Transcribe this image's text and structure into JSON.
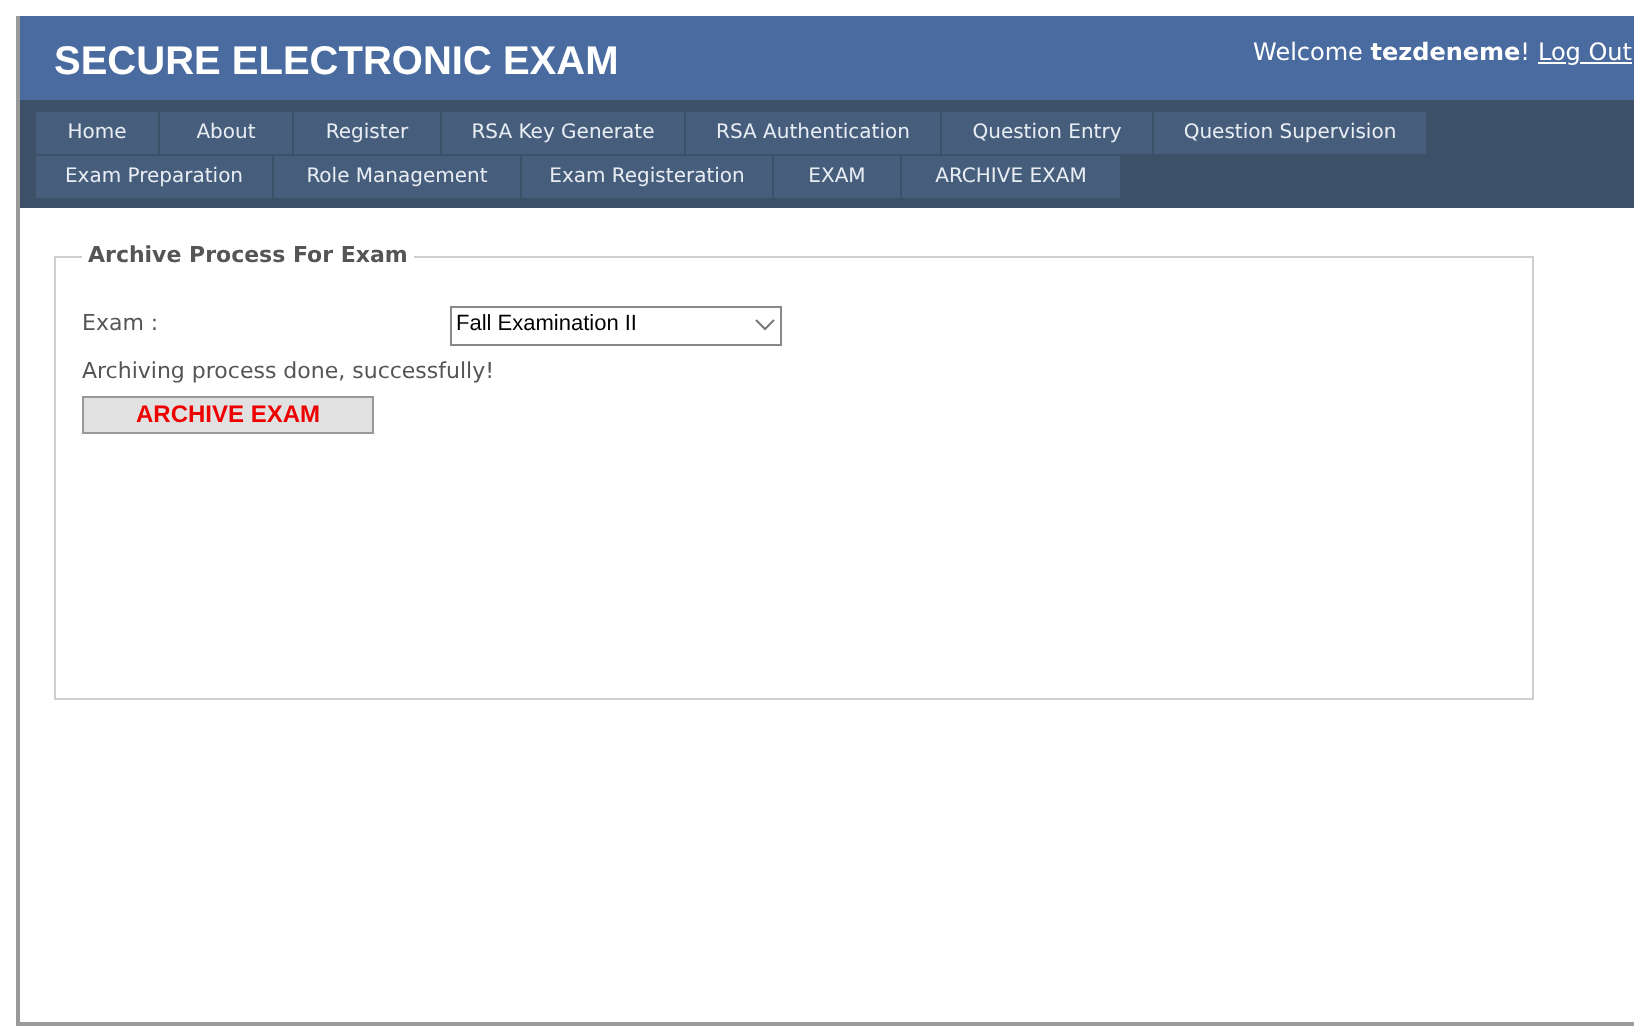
{
  "header": {
    "title": "SECURE ELECTRONIC EXAM",
    "welcome": "Welcome **tezdeneme**!",
    "logout": "Log Out"
  },
  "menu": [
    [
      {
        "label": "Home"
      },
      {
        "label": "About"
      },
      {
        "label": "Register"
      },
      {
        "label": "RSA Key Generate"
      },
      {
        "label": "RSA Authentication"
      },
      {
        "label": "Question Entry"
      },
      {
        "label": "Question Supervision"
      }
    ],
    [
      {
        "label": "Exam Preparation"
      },
      {
        "label": "Role Management"
      },
      {
        "label": "Exam Registeration"
      },
      {
        "label": "EXAM"
      },
      {
        "label": "ARCHIVE EXAM"
      }
    ]
  ],
  "panel": {
    "legend": "Archive Process For Exam",
    "exam_label": "Exam :",
    "exam_value": "Fall Examination II",
    "message": "Archiving process done, successfully!",
    "button": "ARCHIVE EXAM"
  }
}
